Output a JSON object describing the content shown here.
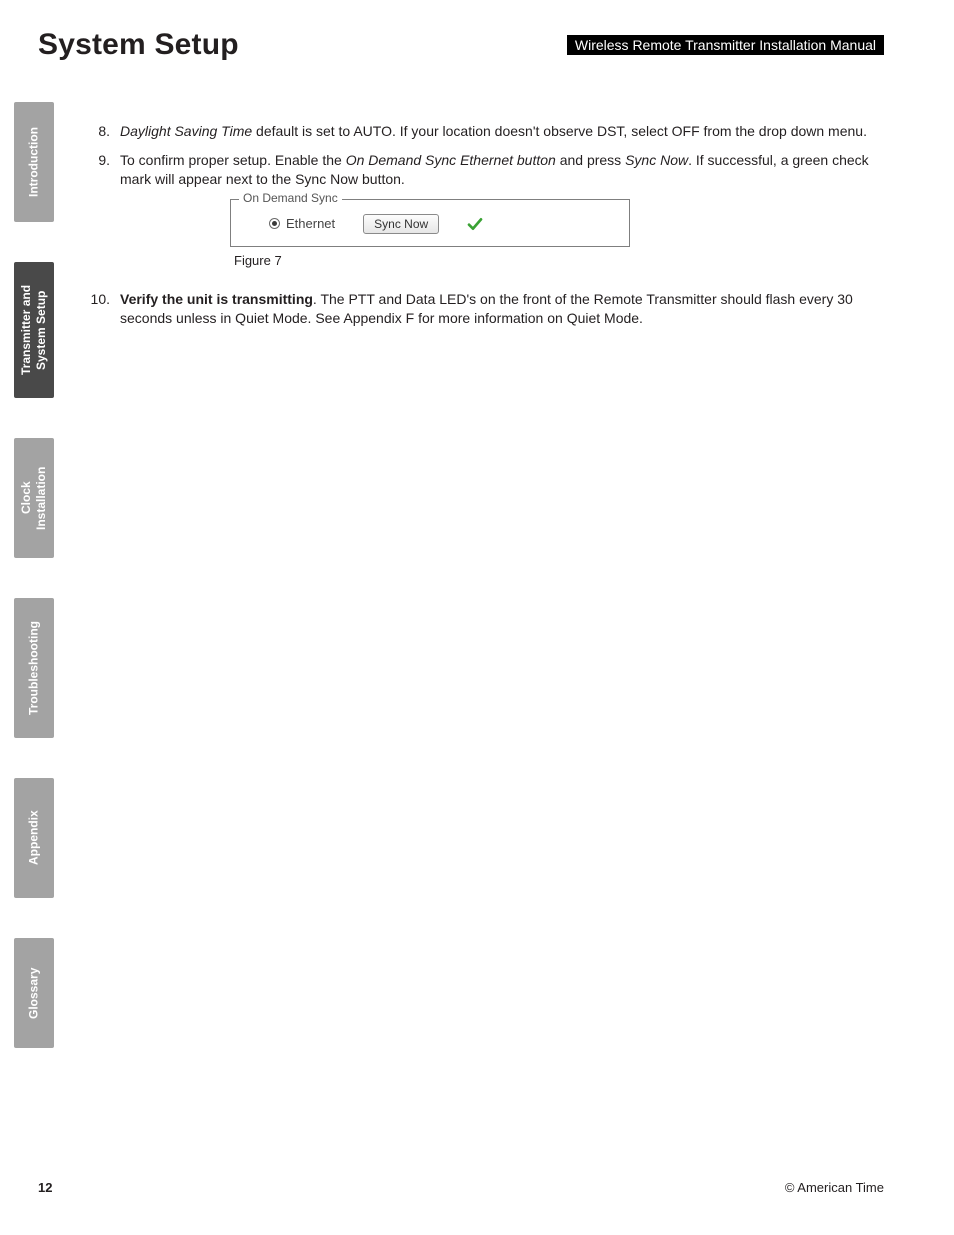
{
  "header": {
    "title": "System Setup",
    "manual_label": "Wireless Remote Transmitter Installation Manual"
  },
  "tabs": {
    "t1": "Introduction",
    "t2": "Transmitter and System Setup",
    "t3": "Clock Installation",
    "t4": "Troubleshooting",
    "t5": "Appendix",
    "t6": "Glossary"
  },
  "steps": {
    "s8": {
      "num": "8.",
      "lead_italic": "Daylight Saving Time",
      "rest": " default is set to AUTO. If your location doesn't observe DST, select OFF from the drop down menu."
    },
    "s9": {
      "num": "9.",
      "a": "To confirm proper setup. Enable the ",
      "i1": "On Demand Sync Ethernet button",
      "b": " and press ",
      "i2": "Sync Now",
      "c": ". If successful, a green check mark will appear next to the Sync Now button."
    },
    "s10": {
      "num": "10.",
      "bold": "Verify the unit is transmitting",
      "rest": ". The PTT and Data LED's on the front of the Remote Transmitter should flash every 30 seconds unless in Quiet Mode. See Appendix F for more information on Quiet Mode."
    }
  },
  "figure": {
    "legend": "On Demand Sync",
    "radio_label": "Ethernet",
    "button_label": "Sync Now",
    "caption": "Figure 7"
  },
  "footer": {
    "page_number": "12",
    "copyright": "© American Time"
  }
}
